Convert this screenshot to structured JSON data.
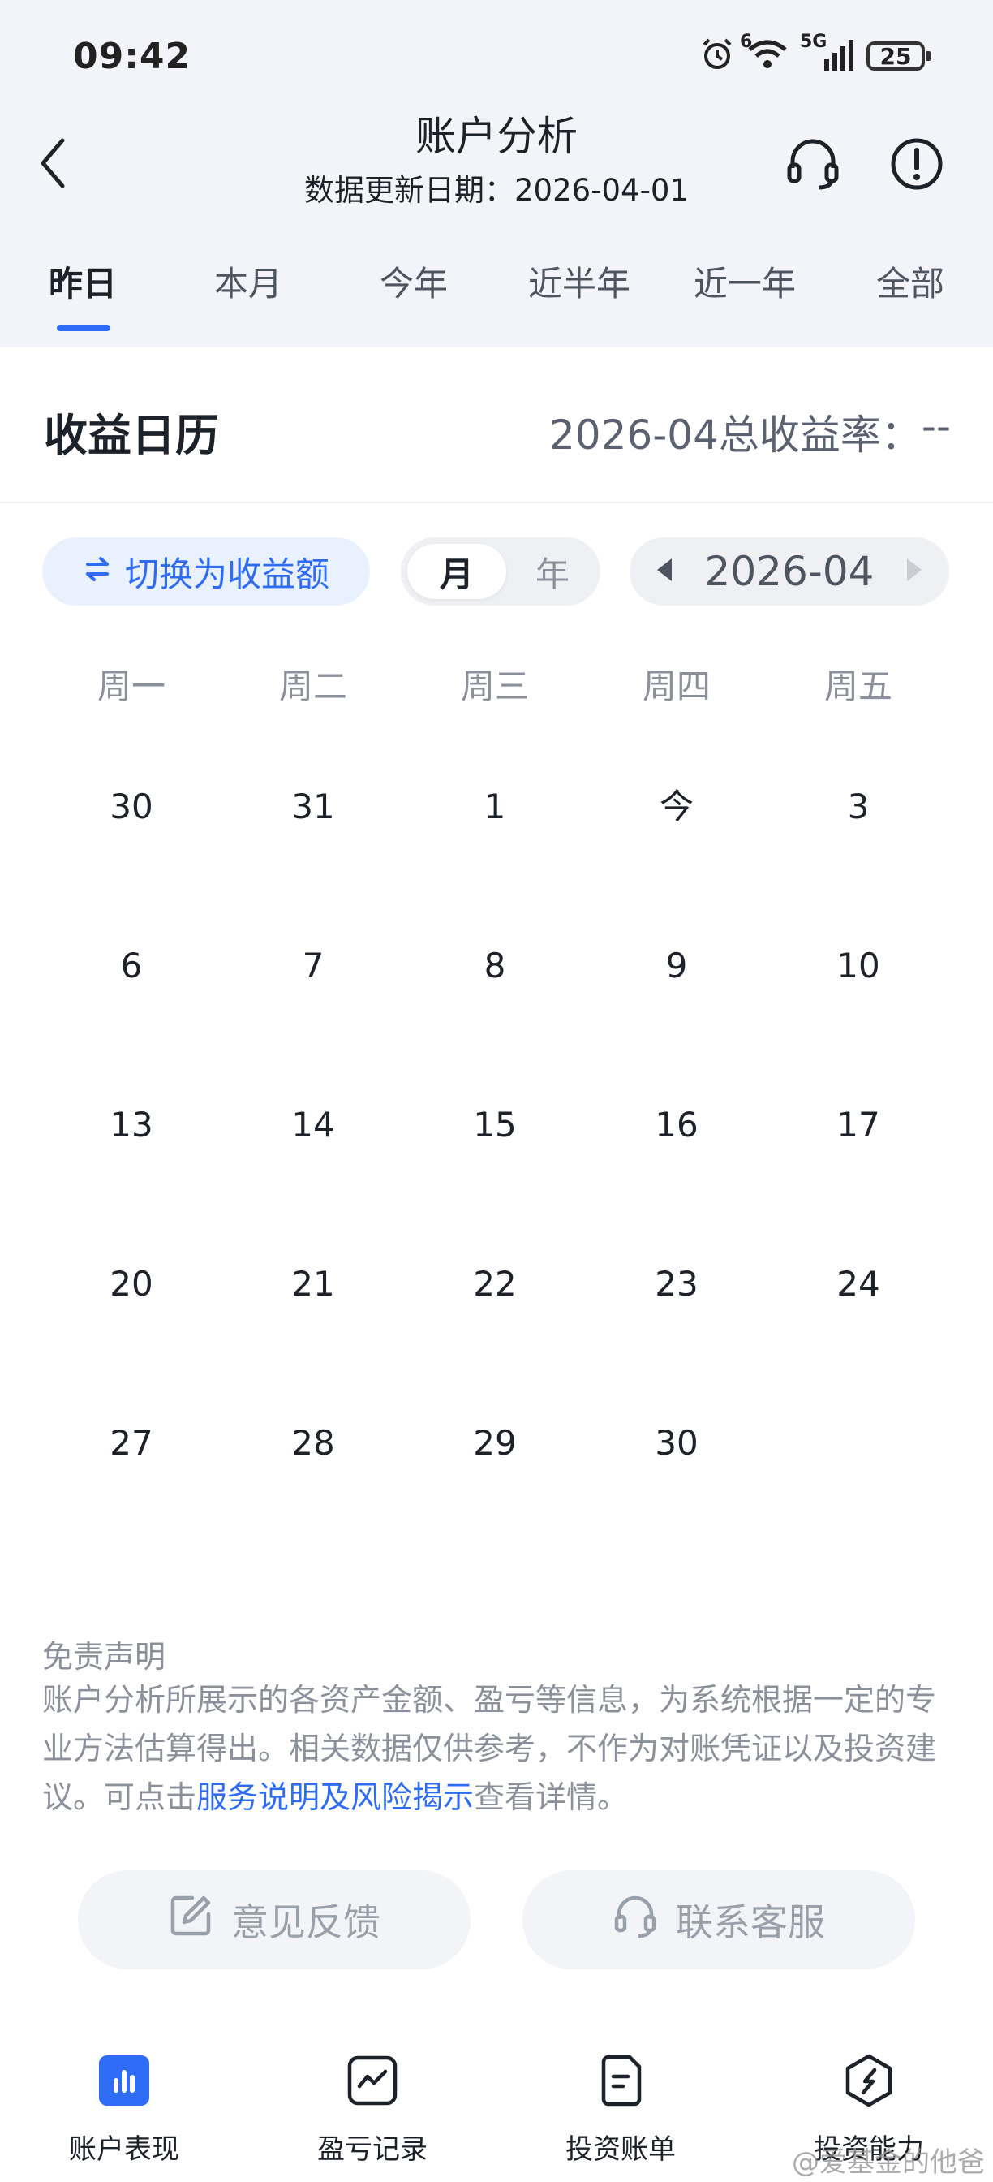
{
  "status_bar": {
    "time": "09:42",
    "network_label": "5G",
    "wifi_label": "6",
    "battery": "25",
    "icons": [
      "alarm-icon",
      "wifi-icon",
      "signal-icon",
      "battery-icon"
    ]
  },
  "header": {
    "title": "账户分析",
    "subtitle": "数据更新日期：2026-04-01",
    "icons": [
      "back-icon",
      "headset-icon",
      "info-icon"
    ]
  },
  "tabs": [
    {
      "label": "昨日",
      "active": true
    },
    {
      "label": "本月",
      "active": false
    },
    {
      "label": "今年",
      "active": false
    },
    {
      "label": "近半年",
      "active": false
    },
    {
      "label": "近一年",
      "active": false
    },
    {
      "label": "全部",
      "active": false
    }
  ],
  "calendar_section": {
    "title": "收益日历",
    "rate_label": "2026-04总收益率：",
    "rate_value": "--",
    "switch_label": "切换为收益额",
    "segment": {
      "month": "月",
      "year": "年",
      "selected": "月"
    },
    "current_month": "2026-04",
    "weekdays": [
      "周一",
      "周二",
      "周三",
      "周四",
      "周五"
    ],
    "weeks": [
      [
        "30",
        "31",
        "1",
        "今",
        "3"
      ],
      [
        "6",
        "7",
        "8",
        "9",
        "10"
      ],
      [
        "13",
        "14",
        "15",
        "16",
        "17"
      ],
      [
        "20",
        "21",
        "22",
        "23",
        "24"
      ],
      [
        "27",
        "28",
        "29",
        "30",
        ""
      ]
    ]
  },
  "disclaimer": {
    "title": "免责声明",
    "text_before": "账户分析所展示的各资产金额、盈亏等信息，为系统根据一定的专业方法估算得出。相关数据仅供参考，不作为对账凭证以及投资建议。可点击",
    "link": "服务说明及风险揭示",
    "text_after": "查看详情。"
  },
  "actions": {
    "feedback": "意见反馈",
    "service": "联系客服"
  },
  "bottom_nav": [
    {
      "label": "账户表现",
      "icon": "bar-chart-icon",
      "active": true
    },
    {
      "label": "盈亏记录",
      "icon": "trend-icon",
      "active": false
    },
    {
      "label": "投资账单",
      "icon": "bill-icon",
      "active": false
    },
    {
      "label": "投资能力",
      "icon": "compass-icon",
      "active": false
    }
  ],
  "watermark": "@爱基金的他爸",
  "colors": {
    "accent": "#2e6cf6",
    "background_top": "#f2f4f9",
    "text": "#1d2129",
    "muted": "#8b909a"
  }
}
